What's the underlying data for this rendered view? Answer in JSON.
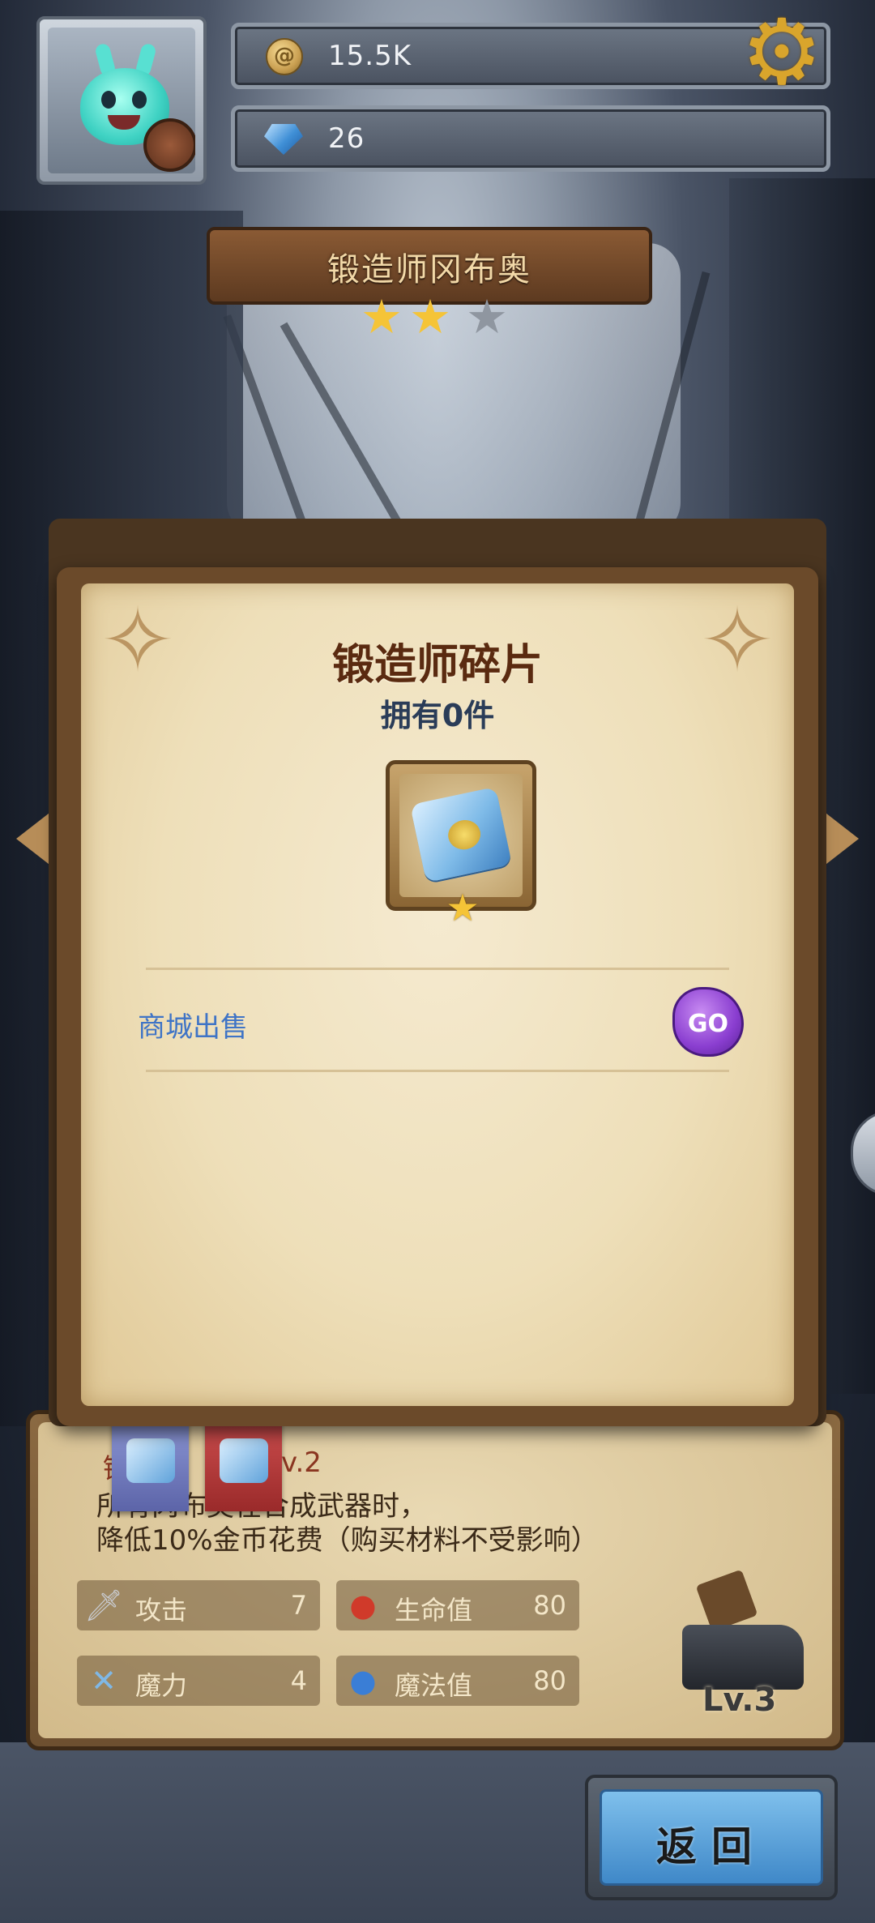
{
  "hud": {
    "coins": "15.5K",
    "gems": "26",
    "coin_icon": "coin-icon",
    "gem_icon": "gem-icon",
    "settings_icon": "gear-icon"
  },
  "hero": {
    "name": "锻造师冈布奥",
    "stars_filled": 2,
    "stars_total": 3
  },
  "modal": {
    "title": "锻造师碎片",
    "owned": "拥有0件",
    "item_star": "★",
    "source_label": "商城出售",
    "go_label": "GO"
  },
  "info": {
    "skill_title_prefix": "锻",
    "skill_title_suffix": "v.2",
    "desc_line1": "所有冈布奥在合成武器时，",
    "desc_line2": "降低10%金币花费（购买材料不受影响）",
    "stats": [
      {
        "label": "攻击",
        "value": "7",
        "icon": "sword-icon"
      },
      {
        "label": "生命值",
        "value": "80",
        "icon": "red-potion-icon"
      },
      {
        "label": "魔力",
        "value": "4",
        "icon": "staff-icon"
      },
      {
        "label": "魔法值",
        "value": "80",
        "icon": "blue-potion-icon"
      }
    ],
    "anvil_level": "Lv.3"
  },
  "buttons": {
    "back_label": "返回"
  },
  "colors": {
    "star_gold": "#f5c437",
    "star_empty": "#8f96a0",
    "link_blue": "#3f74c6",
    "go_purple": "#8a3ed0"
  }
}
